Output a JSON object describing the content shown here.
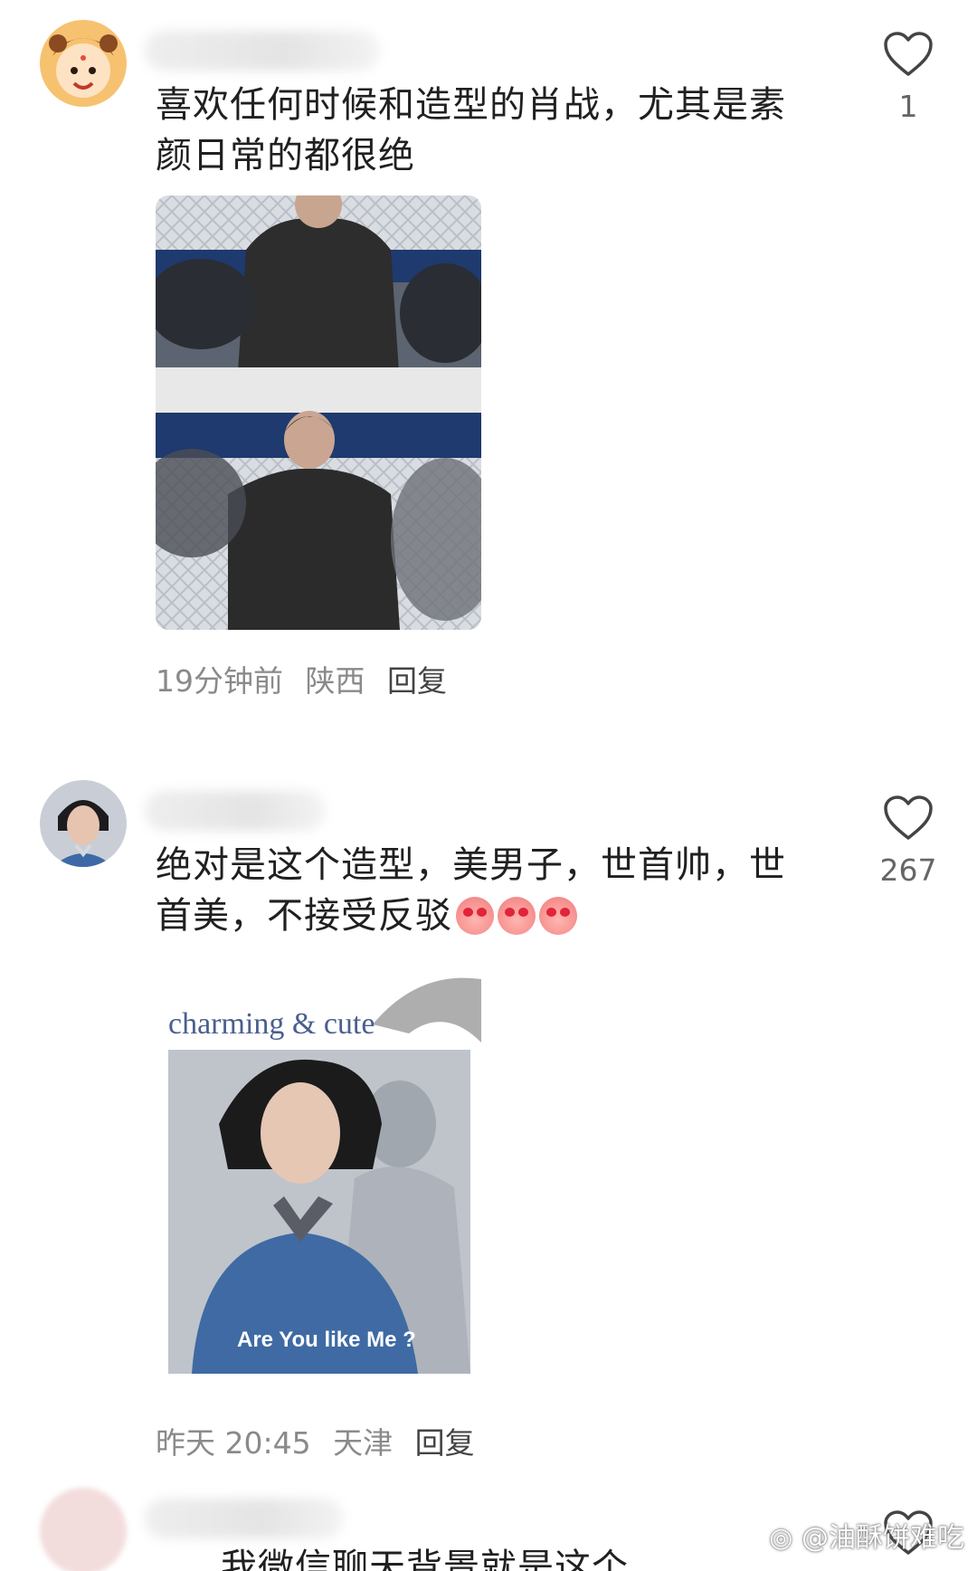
{
  "comments": [
    {
      "text": "喜欢任何时候和造型的肖战，尤其是素颜日常的都很绝",
      "time": "19分钟前",
      "location": "陕西",
      "reply": "回复",
      "likes": "1"
    },
    {
      "text": "绝对是这个造型，美男子，世首帅，世首美，不接受反驳",
      "time": "昨天 20:45",
      "location": "天津",
      "reply": "回复",
      "likes": "267",
      "image_caption_top": "charming & cute",
      "image_caption_bottom": "Are You like Me ?"
    },
    {
      "text": "我微信聊天背景就是这个"
    }
  ],
  "watermark": "@油酥饼难吃",
  "colors": {
    "text": "#202020",
    "meta": "#8a8a8a",
    "background": "#ffffff"
  }
}
